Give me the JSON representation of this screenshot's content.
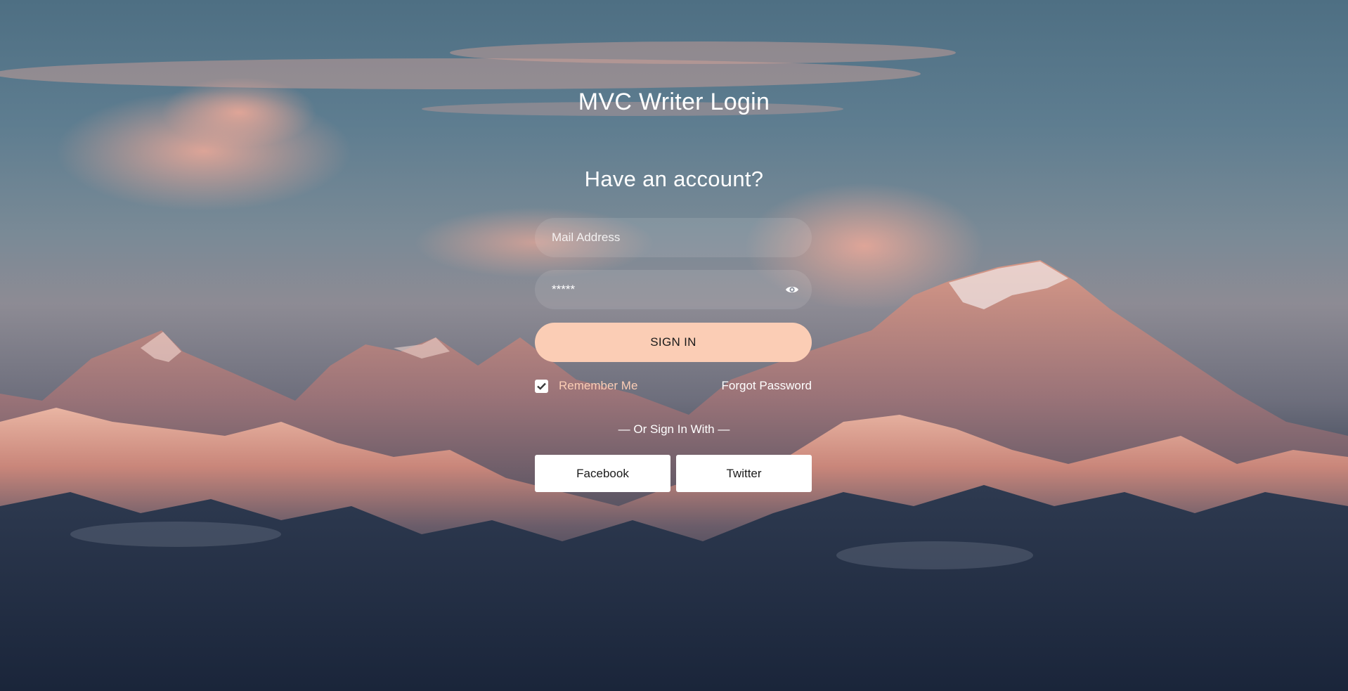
{
  "page": {
    "title": "MVC Writer Login",
    "subtitle": "Have an account?"
  },
  "form": {
    "email_placeholder": "Mail Address",
    "email_value": "",
    "password_value": "*****",
    "password_toggle_icon": "eye-icon",
    "signin_label": "SIGN IN",
    "remember_label": "Remember Me",
    "remember_checked": true,
    "forgot_label": "Forgot Password"
  },
  "social": {
    "divider": "— Or Sign In With —",
    "facebook_label": "Facebook",
    "twitter_label": "Twitter"
  },
  "colors": {
    "accent": "#fbcdb5",
    "button_text": "#1a1a1a",
    "text": "#ffffff"
  }
}
